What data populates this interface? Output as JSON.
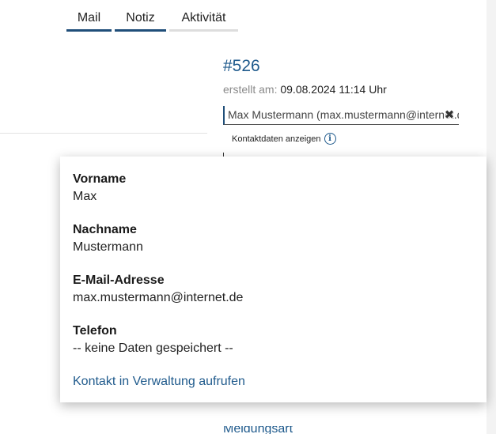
{
  "tabs": [
    {
      "label": "Mail",
      "active": true
    },
    {
      "label": "Notiz",
      "active": true
    },
    {
      "label": "Aktivität",
      "active": false
    }
  ],
  "ticket": {
    "id": "#526",
    "created_label": "erstellt am:",
    "created_value": "09.08.2024 11:14 Uhr"
  },
  "contact_field": {
    "value": "Max Mustermann (max.mustermann@internet.de)"
  },
  "show_contact": {
    "label": "Kontaktdaten anzeigen"
  },
  "contact_popup": {
    "fields": [
      {
        "label": "Vorname",
        "value": "Max"
      },
      {
        "label": "Nachname",
        "value": "Mustermann"
      },
      {
        "label": "E-Mail-Adresse",
        "value": "max.mustermann@internet.de"
      },
      {
        "label": "Telefon",
        "value": "-- keine Daten gespeichert --"
      }
    ],
    "link_label": "Kontakt in Verwaltung aufrufen"
  },
  "bottom_link": {
    "label": "Meldungsart"
  },
  "colors": {
    "accent": "#1f5a8c",
    "tab_active": "#1f4e79",
    "tab_inactive": "#dddddd"
  }
}
